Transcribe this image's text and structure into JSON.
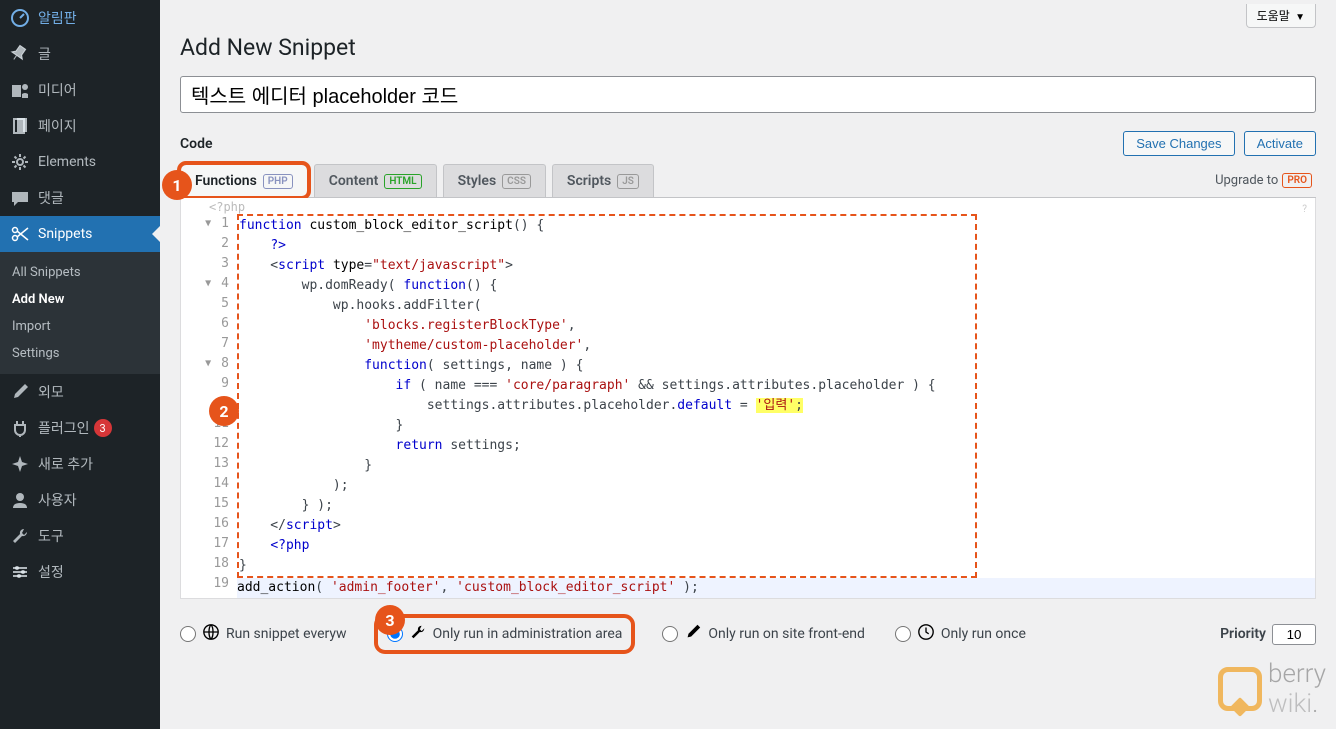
{
  "sidebar": {
    "items": [
      {
        "label": "알림판",
        "icon": "dashboard"
      },
      {
        "label": "글",
        "icon": "pin"
      },
      {
        "label": "미디어",
        "icon": "media"
      },
      {
        "label": "페이지",
        "icon": "page"
      },
      {
        "label": "Elements",
        "icon": "gear"
      },
      {
        "label": "댓글",
        "icon": "comment"
      },
      {
        "label": "Snippets",
        "icon": "scissors",
        "active": true
      },
      {
        "label": "외모",
        "icon": "brush"
      },
      {
        "label": "플러그인",
        "icon": "plug",
        "badge": "3"
      },
      {
        "label": "새로 추가",
        "icon": "sparkle"
      },
      {
        "label": "사용자",
        "icon": "user"
      },
      {
        "label": "도구",
        "icon": "wrench"
      },
      {
        "label": "설정",
        "icon": "sliders"
      }
    ],
    "submenu": [
      {
        "label": "All Snippets"
      },
      {
        "label": "Add New",
        "current": true
      },
      {
        "label": "Import"
      },
      {
        "label": "Settings"
      }
    ]
  },
  "header": {
    "help": "도움말",
    "page_title": "Add New Snippet",
    "snippet_title": "텍스트 에디터 placeholder 코드"
  },
  "section": {
    "code_label": "Code",
    "save": "Save Changes",
    "activate": "Activate"
  },
  "tabs": {
    "functions": "Functions",
    "functions_chip": "PHP",
    "content": "Content",
    "content_chip": "HTML",
    "styles": "Styles",
    "styles_chip": "CSS",
    "scripts": "Scripts",
    "scripts_chip": "JS",
    "upgrade": "Upgrade to",
    "upgrade_chip": "PRO"
  },
  "editor": {
    "php_open": "<?php",
    "lines": [
      "function custom_block_editor_script() {",
      "    ?>",
      "    <script type=\"text/javascript\">",
      "        wp.domReady( function() {",
      "            wp.hooks.addFilter(",
      "                'blocks.registerBlockType',",
      "                'mytheme/custom-placeholder',",
      "                function( settings, name ) {",
      "                    if ( name === 'core/paragraph' && settings.attributes.placeholder ) {",
      "                        settings.attributes.placeholder.default = '입력';",
      "                    }",
      "                    return settings;",
      "                }",
      "            );",
      "        } );",
      "    </script>",
      "    <?php",
      "}",
      "add_action( 'admin_footer', 'custom_block_editor_script' );"
    ]
  },
  "run": {
    "everywhere": "Run snippet everyw",
    "admin": "Only run in administration area",
    "frontend": "Only run on site front-end",
    "once": "Only run once",
    "priority_label": "Priority",
    "priority_value": "10"
  },
  "watermark": {
    "text": "berry",
    "text2": "wiki"
  },
  "annotations": {
    "b1": "1",
    "b2": "2",
    "b3": "3"
  }
}
